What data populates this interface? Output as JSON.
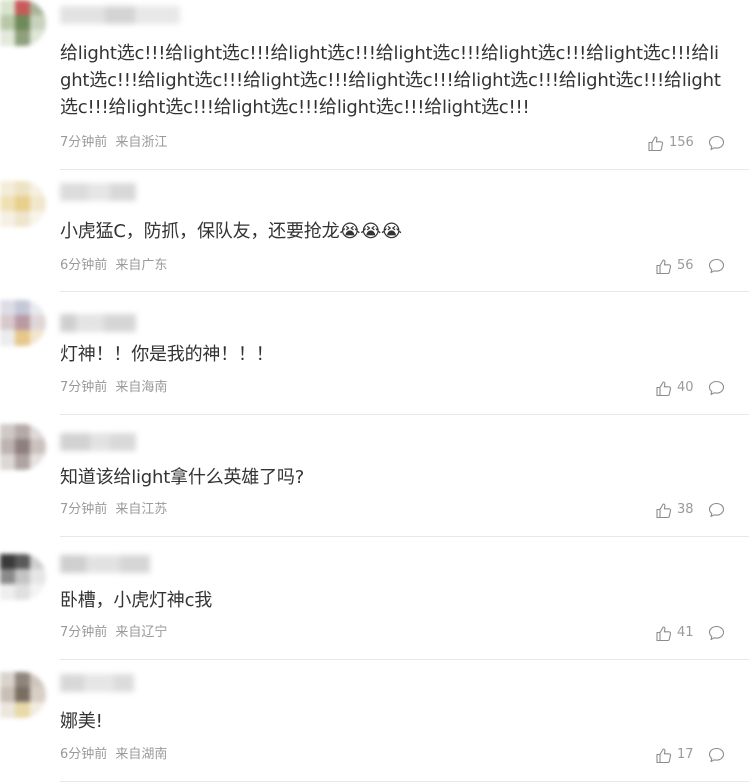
{
  "comments": [
    {
      "text": "给light选c!!!给light选c!!!给light选c!!!给light选c!!!给light选c!!!给light选c!!!给light选c!!!给light选c!!!给light选c!!!给light选c!!!给light选c!!!给light选c!!!给light选c!!!给light选c!!!给light选c!!!给light选c!!!给light选c!!!",
      "time": "7分钟前",
      "location": "来自浙江",
      "likes": "156"
    },
    {
      "text": "小虎猛C，防抓，保队友，还要抢龙😭😭😭",
      "time": "6分钟前",
      "location": "来自广东",
      "likes": "56"
    },
    {
      "text": "灯神！！你是我的神！！！",
      "time": "7分钟前",
      "location": "来自海南",
      "likes": "40"
    },
    {
      "text": "知道该给light拿什么英雄了吗?",
      "time": "7分钟前",
      "location": "来自江苏",
      "likes": "38"
    },
    {
      "text": "卧槽，小虎灯神c我",
      "time": "7分钟前",
      "location": "来自辽宁",
      "likes": "41"
    },
    {
      "text": "娜美!",
      "time": "6分钟前",
      "location": "来自湖南",
      "likes": "17"
    }
  ],
  "icons": {
    "like": "thumbs-up-icon",
    "reply": "comment-bubble-icon"
  },
  "colors": {
    "text": "#333333",
    "meta": "#9a9a9a",
    "divider": "#e8e8e8"
  }
}
